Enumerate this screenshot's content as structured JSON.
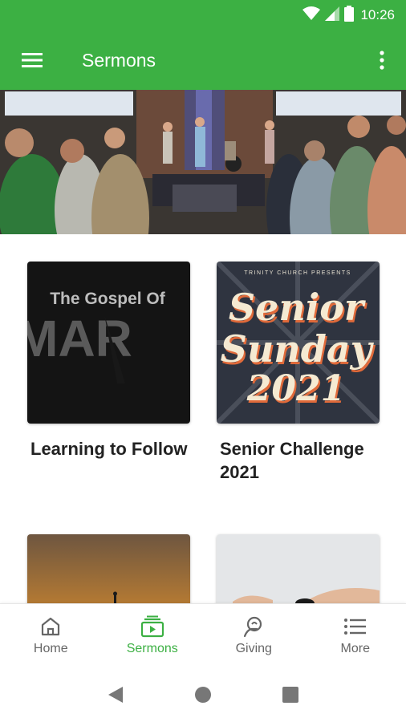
{
  "status_bar": {
    "time": "10:26",
    "icons": [
      "wifi-icon",
      "signal-icon",
      "battery-icon"
    ]
  },
  "app_bar": {
    "title": "Sermons",
    "color": "#3cb043",
    "menu_icon": "menu-icon",
    "overflow_icon": "more-vert-icon"
  },
  "hero": {
    "description_icon": "worship-band-photo"
  },
  "sermons": [
    {
      "title": "Learning to Follow",
      "thumb_text": "The Gospel Of",
      "thumb_text_large": "MAR"
    },
    {
      "title": "Senior Challenge 2021",
      "thumb_eyebrow": "TRINITY CHURCH PRESENTS",
      "thumb_line1": "Senior",
      "thumb_line2": "Sunday",
      "thumb_line3": "2021"
    },
    {
      "title": ""
    },
    {
      "title": ""
    }
  ],
  "bottom_nav": {
    "items": [
      {
        "label": "Home",
        "icon": "home-icon",
        "active": false
      },
      {
        "label": "Sermons",
        "icon": "sermons-icon",
        "active": true
      },
      {
        "label": "Giving",
        "icon": "giving-icon",
        "active": false
      },
      {
        "label": "More",
        "icon": "list-icon",
        "active": false
      }
    ],
    "active_color": "#3cb043",
    "inactive_color": "#666666"
  },
  "system_nav": {
    "icons": [
      "back-icon",
      "home-circle-icon",
      "recents-icon"
    ]
  }
}
